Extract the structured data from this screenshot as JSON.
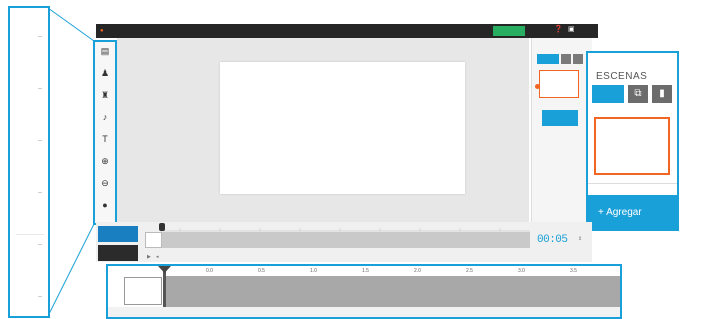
{
  "topbar": {
    "menu_items": [
      "",
      "",
      "",
      "",
      ""
    ],
    "share_label": "",
    "title": ""
  },
  "tools": [
    {
      "name": "",
      "icon": "image-icon"
    },
    {
      "name": "",
      "icon": "character-icon"
    },
    {
      "name": "",
      "icon": "props-icon"
    },
    {
      "name": "",
      "icon": "music-icon"
    },
    {
      "name": "",
      "icon": "text-icon"
    },
    {
      "name": "",
      "icon": "zoom-in-icon"
    },
    {
      "name": "",
      "icon": "zoom-out-icon"
    },
    {
      "name": "",
      "icon": "fx-icon"
    }
  ],
  "canvas": {
    "logo": ""
  },
  "right_panel": {
    "title": "",
    "add_label": ""
  },
  "right_zoom": {
    "title": "ESCENAS",
    "add_label": "+ Agregar"
  },
  "timeline": {
    "scene_button": "",
    "second_button": "",
    "label": "",
    "time": "00:05",
    "unit": ""
  },
  "bottom_zoom": {
    "ticks": [
      "0.0",
      "0.5",
      "1.0",
      "1.5",
      "2.0",
      "2.5",
      "3.0",
      "3.5"
    ]
  },
  "colors": {
    "accent": "#1aa0d8",
    "orange": "#f26522",
    "topbar": "#262626",
    "share": "#27ae60"
  }
}
